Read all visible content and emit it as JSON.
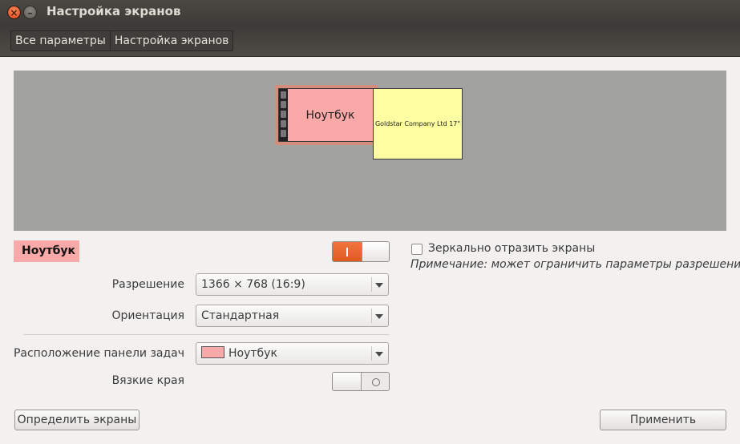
{
  "window": {
    "title": "Настройка экранов",
    "close_glyph": "×",
    "minimize_glyph": "–"
  },
  "breadcrumbs": [
    "Все параметры",
    "Настройка экранов"
  ],
  "arrangement": {
    "laptop_label": "Ноутбук",
    "external_label": "Goldstar Company Ltd 17\""
  },
  "selected_display": {
    "name": "Ноутбук",
    "enabled": true
  },
  "settings": {
    "resolution_label": "Разрешение",
    "resolution_value": "1366 × 768 (16:9)",
    "orientation_label": "Ориентация",
    "orientation_value": "Стандартная",
    "launcher_label": "Расположение панели задач",
    "launcher_value": "Ноутбук",
    "sticky_label": "Вязкие края",
    "sticky_enabled": false
  },
  "mirror": {
    "label": "Зеркально отразить экраны",
    "checked": false,
    "note": "Примечание: может ограничить параметры разрешения"
  },
  "buttons": {
    "detect": "Определить экраны",
    "apply": "Применить"
  },
  "colors": {
    "laptop": "#f9a9a7",
    "external": "#fdfea2",
    "accent": "#e05a20"
  }
}
